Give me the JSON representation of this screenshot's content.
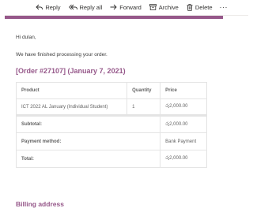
{
  "toolbar": {
    "reply": "Reply",
    "reply_all": "Reply all",
    "forward": "Forward",
    "archive": "Archive",
    "delete": "Delete",
    "more": "···"
  },
  "email": {
    "accent_color": "#96588a",
    "greeting": "Hi dulan,",
    "intro": "We have finished processing your order.",
    "order_title": "[Order #27107] (January 7, 2021)",
    "table": {
      "headers": [
        "Product",
        "Quantity",
        "Price"
      ],
      "items": [
        {
          "product": "ICT 2022 AL January (Individual Student)",
          "quantity": "1",
          "price": "රු2,000.00"
        }
      ],
      "totals": [
        {
          "label": "Subtotal:",
          "value": "රු2,000.00"
        },
        {
          "label": "Payment method:",
          "value": "Bank Payment"
        },
        {
          "label": "Total:",
          "value": "රු2,000.00"
        }
      ]
    },
    "billing_heading": "Billing address"
  }
}
